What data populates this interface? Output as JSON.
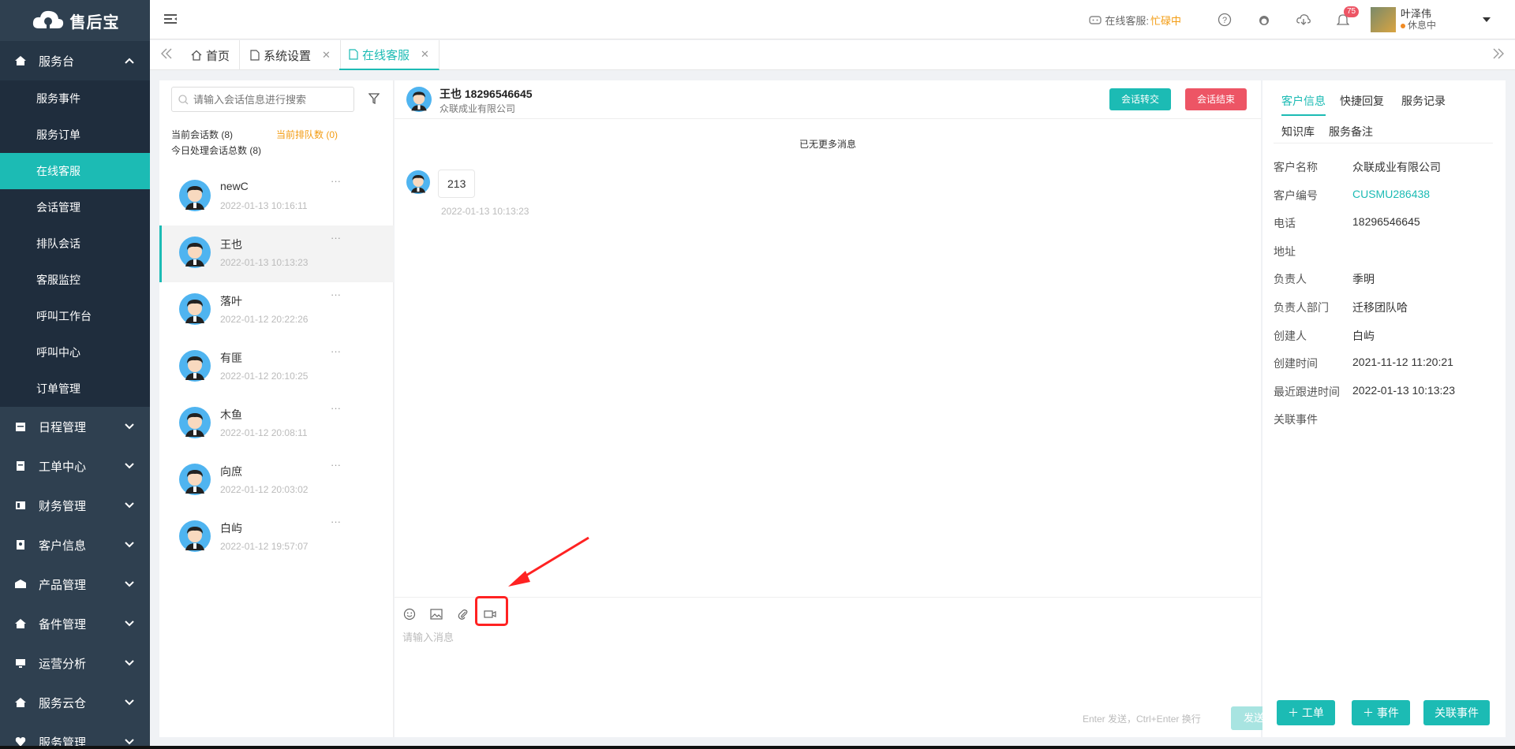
{
  "brand": {
    "name": "售后宝"
  },
  "sidebar": {
    "groups": [
      {
        "label": "服务台",
        "icon": "home-icon",
        "open": true,
        "items": [
          "服务事件",
          "服务订单",
          "在线客服",
          "会话管理",
          "排队会话",
          "客服监控",
          "呼叫工作台",
          "呼叫中心",
          "订单管理"
        ],
        "active": "在线客服"
      },
      {
        "label": "日程管理",
        "icon": "calendar-icon"
      },
      {
        "label": "工单中心",
        "icon": "clipboard-icon"
      },
      {
        "label": "财务管理",
        "icon": "finance-icon"
      },
      {
        "label": "客户信息",
        "icon": "contact-icon"
      },
      {
        "label": "产品管理",
        "icon": "product-icon"
      },
      {
        "label": "备件管理",
        "icon": "parts-icon"
      },
      {
        "label": "运营分析",
        "icon": "monitor-icon"
      },
      {
        "label": "服务云仓",
        "icon": "warehouse-icon"
      },
      {
        "label": "服务管理",
        "icon": "heart-icon"
      }
    ]
  },
  "topbar": {
    "status_label": "在线客服:",
    "status_value": "忙碌中",
    "notification_count": "75",
    "user_name": "叶泽伟",
    "user_state": "休息中"
  },
  "tabs": [
    {
      "label": "首页",
      "closable": false
    },
    {
      "label": "系统设置",
      "closable": true
    },
    {
      "label": "在线客服",
      "closable": true,
      "active": true
    }
  ],
  "conversations": {
    "search_placeholder": "请输入会话信息进行搜索",
    "current_count": "当前会话数 (8)",
    "queue_count": "当前排队数 (0)",
    "today_total": "今日处理会话总数 (8)",
    "items": [
      {
        "name": "newC",
        "time": "2022-01-13 10:16:11"
      },
      {
        "name": "王也",
        "time": "2022-01-13 10:13:23",
        "active": true
      },
      {
        "name": "落叶",
        "time": "2022-01-12 20:22:26"
      },
      {
        "name": "有匪",
        "time": "2022-01-12 20:10:25"
      },
      {
        "name": "木鱼",
        "time": "2022-01-12 20:08:11"
      },
      {
        "name": "向庶",
        "time": "2022-01-12 20:03:02"
      },
      {
        "name": "白屿",
        "time": "2022-01-12 19:57:07"
      }
    ],
    "more_glyph": "···"
  },
  "chat": {
    "contact_title": "王也 18296546645",
    "company": "众联成业有限公司",
    "transfer_label": "会话转交",
    "end_label": "会话结束",
    "no_more": "已无更多消息",
    "messages": [
      {
        "text": "213",
        "time": "2022-01-13 10:13:23"
      }
    ],
    "input_placeholder": "请输入消息",
    "hint": "Enter 发送，Ctrl+Enter 换行",
    "send_label": "发送"
  },
  "info": {
    "tabs": [
      "客户信息",
      "快捷回复",
      "服务记录",
      "知识库",
      "服务备注"
    ],
    "active_tab": "客户信息",
    "fields": [
      {
        "key": "客户名称",
        "value": "众联成业有限公司"
      },
      {
        "key": "客户编号",
        "value": "CUSMU286438",
        "link": true
      },
      {
        "key": "电话",
        "value": "18296546645"
      },
      {
        "key": "地址",
        "value": ""
      },
      {
        "key": "负责人",
        "value": "季明"
      },
      {
        "key": "负责人部门",
        "value": "迁移团队哈"
      },
      {
        "key": "创建人",
        "value": "白屿"
      },
      {
        "key": "创建时间",
        "value": "2021-11-12 11:20:21"
      },
      {
        "key": "最近跟进时间",
        "value": "2022-01-13 10:13:23"
      },
      {
        "key": "关联事件",
        "value": ""
      }
    ],
    "actions": [
      "＋ 工单",
      "＋ 事件",
      "关联事件"
    ]
  },
  "colors": {
    "accent": "#1cbbb4",
    "danger": "#ed5565",
    "sidebar": "#2f4050",
    "warning": "#f39c12"
  }
}
